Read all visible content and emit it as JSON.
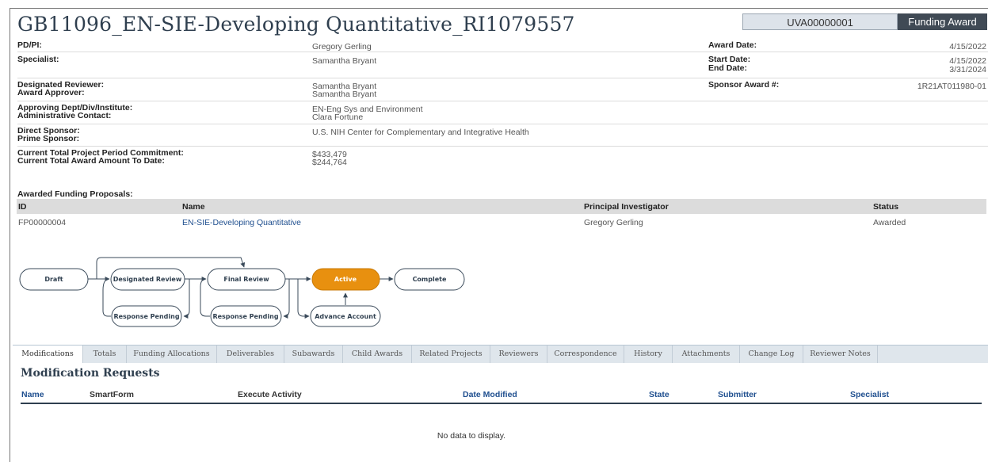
{
  "header": {
    "title": "GB11096_EN-SIE-Developing Quantitative_RI1079557",
    "record_id": "UVA00000001",
    "record_type": "Funding Award"
  },
  "info": {
    "pdpi_label": "PD/PI:",
    "pdpi_value": "Gregory Gerling",
    "specialist_label": "Specialist:",
    "specialist_value": "Samantha Bryant",
    "designated_reviewer_label": "Designated Reviewer:",
    "designated_reviewer_value": "Samantha Bryant",
    "award_approver_label": "Award Approver:",
    "award_approver_value": "Samantha Bryant",
    "approving_dept_label": "Approving Dept/Div/Institute:",
    "approving_dept_value": "EN-Eng Sys and Environment",
    "admin_contact_label": "Administrative Contact:",
    "admin_contact_value": "Clara Fortune",
    "direct_sponsor_label": "Direct Sponsor:",
    "direct_sponsor_value": "U.S. NIH Center for Complementary and Integrative Health",
    "prime_sponsor_label": "Prime Sponsor:",
    "commitment_label": "Current Total Project Period Commitment:",
    "commitment_value": "$433,479",
    "award_amount_label": "Current Total Award Amount To Date:",
    "award_amount_value": "$244,764",
    "award_date_label": "Award Date:",
    "award_date_value": "4/15/2022",
    "start_date_label": "Start Date:",
    "start_date_value": "4/15/2022",
    "end_date_label": "End Date:",
    "end_date_value": "3/31/2024",
    "sponsor_award_label": "Sponsor Award #:",
    "sponsor_award_value": "1R21AT011980-01"
  },
  "funding_proposals": {
    "title": "Awarded Funding Proposals:",
    "columns": [
      "ID",
      "Name",
      "Principal Investigator",
      "Status"
    ],
    "rows": [
      {
        "id": "FP00000004",
        "name": "EN-SIE-Developing Quantitative",
        "pi": "Gregory Gerling",
        "status": "Awarded"
      }
    ]
  },
  "workflow": {
    "active_color": "#e8900f",
    "states": {
      "draft": "Draft",
      "designated_review": "Designated Review",
      "final_review": "Final Review",
      "active": "Active",
      "complete": "Complete",
      "response_pending_1": "Response Pending",
      "response_pending_2": "Response Pending",
      "advance_account": "Advance Account"
    }
  },
  "tabs": [
    "Modifications",
    "Totals",
    "Funding Allocations",
    "Deliverables",
    "Subawards",
    "Child Awards",
    "Related Projects",
    "Reviewers",
    "Correspondence",
    "History",
    "Attachments",
    "Change Log",
    "Reviewer Notes"
  ],
  "modifications": {
    "title": "Modification Requests",
    "columns": [
      "Name",
      "SmartForm",
      "Execute Activity",
      "Date Modified",
      "State",
      "Submitter",
      "Specialist"
    ],
    "empty_text": "No data to display."
  }
}
